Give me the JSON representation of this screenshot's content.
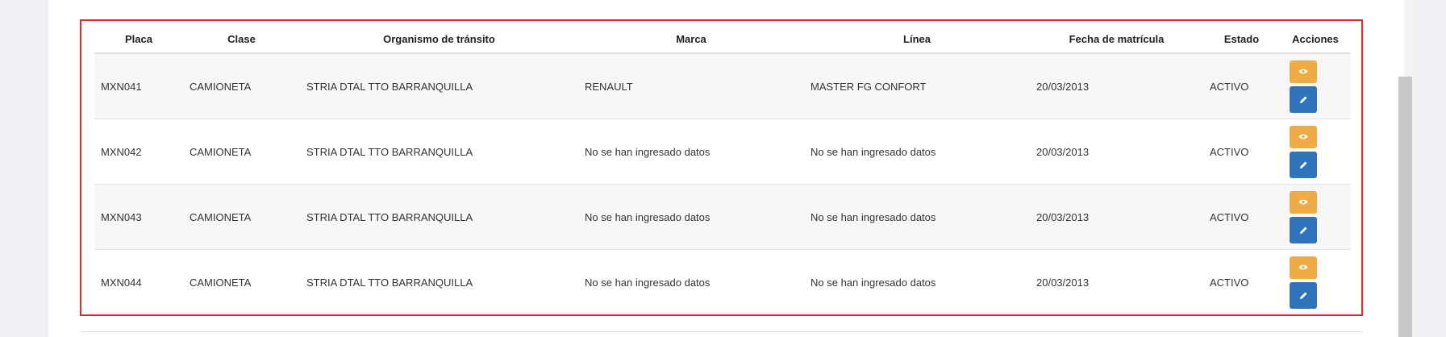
{
  "table": {
    "headers": {
      "placa": "Placa",
      "clase": "Clase",
      "organismo": "Organismo de tránsito",
      "marca": "Marca",
      "linea": "Línea",
      "fecha": "Fecha de matrícula",
      "estado": "Estado",
      "acciones": "Acciones"
    },
    "rows": [
      {
        "placa": "MXN041",
        "clase": "CAMIONETA",
        "organismo": "STRIA DTAL TTO BARRANQUILLA",
        "marca": "RENAULT",
        "linea": "MASTER FG CONFORT",
        "fecha": "20/03/2013",
        "estado": "ACTIVO"
      },
      {
        "placa": "MXN042",
        "clase": "CAMIONETA",
        "organismo": "STRIA DTAL TTO BARRANQUILLA",
        "marca": "No se han ingresado datos",
        "linea": "No se han ingresado datos",
        "fecha": "20/03/2013",
        "estado": "ACTIVO"
      },
      {
        "placa": "MXN043",
        "clase": "CAMIONETA",
        "organismo": "STRIA DTAL TTO BARRANQUILLA",
        "marca": "No se han ingresado datos",
        "linea": "No se han ingresado datos",
        "fecha": "20/03/2013",
        "estado": "ACTIVO"
      },
      {
        "placa": "MXN044",
        "clase": "CAMIONETA",
        "organismo": "STRIA DTAL TTO BARRANQUILLA",
        "marca": "No se han ingresado datos",
        "linea": "No se han ingresado datos",
        "fecha": "20/03/2013",
        "estado": "ACTIVO"
      }
    ],
    "actions": {
      "view_icon": "eye-icon",
      "edit_icon": "pencil-icon"
    }
  },
  "colors": {
    "view_button": "#efac45",
    "edit_button": "#2f73ba",
    "highlight_border": "#e02828"
  }
}
